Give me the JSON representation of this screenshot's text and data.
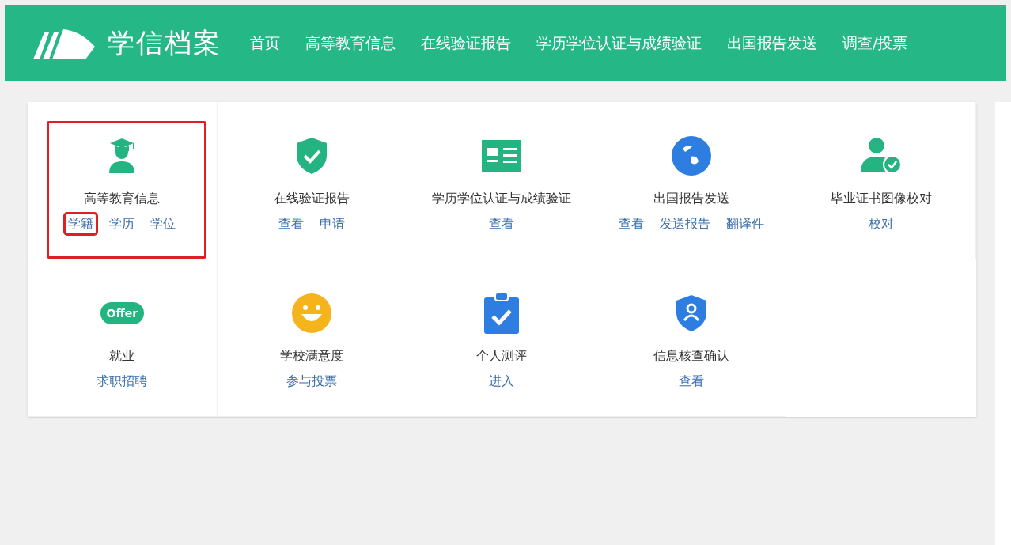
{
  "header": {
    "logo_text": "学信档案",
    "nav": [
      {
        "label": "首页"
      },
      {
        "label": "高等教育信息"
      },
      {
        "label": "在线验证报告"
      },
      {
        "label": "学历学位认证与成绩验证"
      },
      {
        "label": "出国报告发送"
      },
      {
        "label": "调查/投票"
      }
    ]
  },
  "services": [
    {
      "title": "高等教育信息",
      "highlighted": true,
      "links": [
        {
          "label": "学籍",
          "highlighted": true
        },
        {
          "label": "学历",
          "highlighted": false
        },
        {
          "label": "学位",
          "highlighted": false
        }
      ]
    },
    {
      "title": "在线验证报告",
      "highlighted": false,
      "links": [
        {
          "label": "查看",
          "highlighted": false
        },
        {
          "label": "申请",
          "highlighted": false
        }
      ]
    },
    {
      "title": "学历学位认证与成绩验证",
      "highlighted": false,
      "links": [
        {
          "label": "查看",
          "highlighted": false
        }
      ]
    },
    {
      "title": "出国报告发送",
      "highlighted": false,
      "links": [
        {
          "label": "查看",
          "highlighted": false
        },
        {
          "label": "发送报告",
          "highlighted": false
        },
        {
          "label": "翻译件",
          "highlighted": false
        }
      ]
    },
    {
      "title": "毕业证书图像校对",
      "highlighted": false,
      "links": [
        {
          "label": "校对",
          "highlighted": false
        }
      ]
    },
    {
      "icon_text": "Offer",
      "title": "就业",
      "highlighted": false,
      "links": [
        {
          "label": "求职招聘",
          "highlighted": false
        }
      ]
    },
    {
      "title": "学校满意度",
      "highlighted": false,
      "links": [
        {
          "label": "参与投票",
          "highlighted": false
        }
      ]
    },
    {
      "title": "个人测评",
      "highlighted": false,
      "links": [
        {
          "label": "进入",
          "highlighted": false
        }
      ]
    },
    {
      "title": "信息核查确认",
      "highlighted": false,
      "links": [
        {
          "label": "查看",
          "highlighted": false
        }
      ]
    }
  ]
}
